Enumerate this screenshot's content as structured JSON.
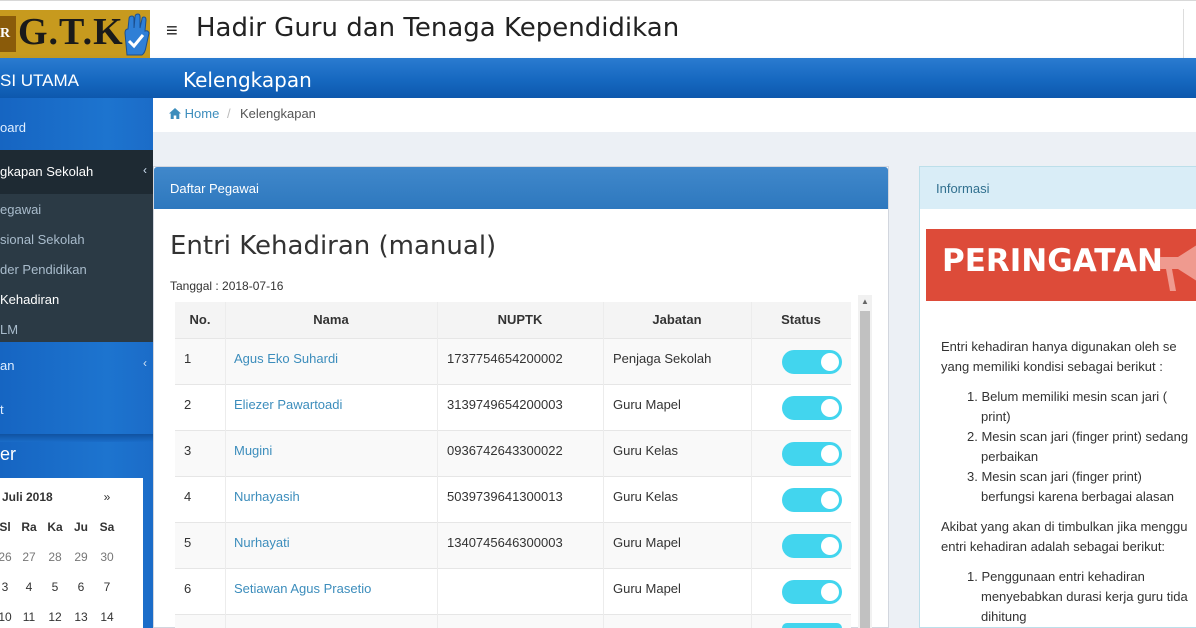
{
  "header": {
    "logo_mark": "R",
    "logo_text": "G.T.K",
    "title": "Hadir Guru dan Tenaga Kependidikan"
  },
  "sidebar": {
    "heading": "SI UTAMA",
    "items": [
      {
        "label": "oard"
      },
      {
        "label": "gkapan Sekolah"
      },
      {
        "label": "egawai"
      },
      {
        "label": "sional Sekolah"
      },
      {
        "label": "der Pendidikan"
      },
      {
        "label": "Kehadiran"
      },
      {
        "label": "LM"
      },
      {
        "label": "an"
      },
      {
        "label": "t"
      }
    ],
    "calendar_heading": "er",
    "calendar": {
      "month": "Juli 2018",
      "next": "»",
      "weekdays": [
        "Sl",
        "Ra",
        "Ka",
        "Ju",
        "Sa"
      ],
      "rows": [
        [
          "26",
          "27",
          "28",
          "29",
          "30"
        ],
        [
          "3",
          "4",
          "5",
          "6",
          "7"
        ],
        [
          "10",
          "11",
          "12",
          "13",
          "14"
        ]
      ]
    }
  },
  "page": {
    "heading": "Kelengkapan",
    "breadcrumb": {
      "home": "Home",
      "sep": "/",
      "current": "Kelengkapan"
    }
  },
  "card": {
    "title": "Daftar Pegawai",
    "heading": "Entri Kehadiran (manual)",
    "date_label": "Tanggal : 2018-07-16",
    "columns": [
      "No.",
      "Nama",
      "NUPTK",
      "Jabatan",
      "Status"
    ],
    "rows": [
      {
        "no": "1",
        "nama": "Agus Eko Suhardi",
        "nuptk": "1737754654200002",
        "jabatan": "Penjaga Sekolah",
        "status": true
      },
      {
        "no": "2",
        "nama": "Eliezer Pawartoadi",
        "nuptk": "3139749654200003",
        "jabatan": "Guru Mapel",
        "status": true
      },
      {
        "no": "3",
        "nama": "Mugini",
        "nuptk": "0936742643300022",
        "jabatan": "Guru Kelas",
        "status": true
      },
      {
        "no": "4",
        "nama": "Nurhayasih",
        "nuptk": "5039739641300013",
        "jabatan": "Guru Kelas",
        "status": true
      },
      {
        "no": "5",
        "nama": "Nurhayati",
        "nuptk": "1340745646300003",
        "jabatan": "Guru Mapel",
        "status": true
      },
      {
        "no": "6",
        "nama": "Setiawan Agus Prasetio",
        "nuptk": "",
        "jabatan": "Guru Mapel",
        "status": true
      }
    ]
  },
  "info": {
    "title": "Informasi",
    "warning": "PERINGATAN",
    "lines": [
      "Entri  kehadiran  hanya  digunakan  oleh  se",
      "yang memiliki kondisi sebagai berikut :",
      "1. Belum   memiliki   mesin   scan   jari   (",
      "print)",
      "2. Mesin scan jari (finger print) sedang",
      "perbaikan",
      "3. Mesin   scan   jari   (finger   print)",
      "berfungsi karena berbagai alasan",
      "Akibat yang akan di timbulkan jika menggu",
      "entri kehadiran adalah sebagai berikut:",
      "1. Penggunaan     entri     kehadiran",
      "menyebabkan durasi kerja guru tida",
      "dihitung"
    ]
  },
  "colors": {
    "primary": "#3c8dbc",
    "danger": "#dd4b39",
    "toggle_on": "#42d5ee",
    "sidebar_dark": "#1e2a33"
  }
}
